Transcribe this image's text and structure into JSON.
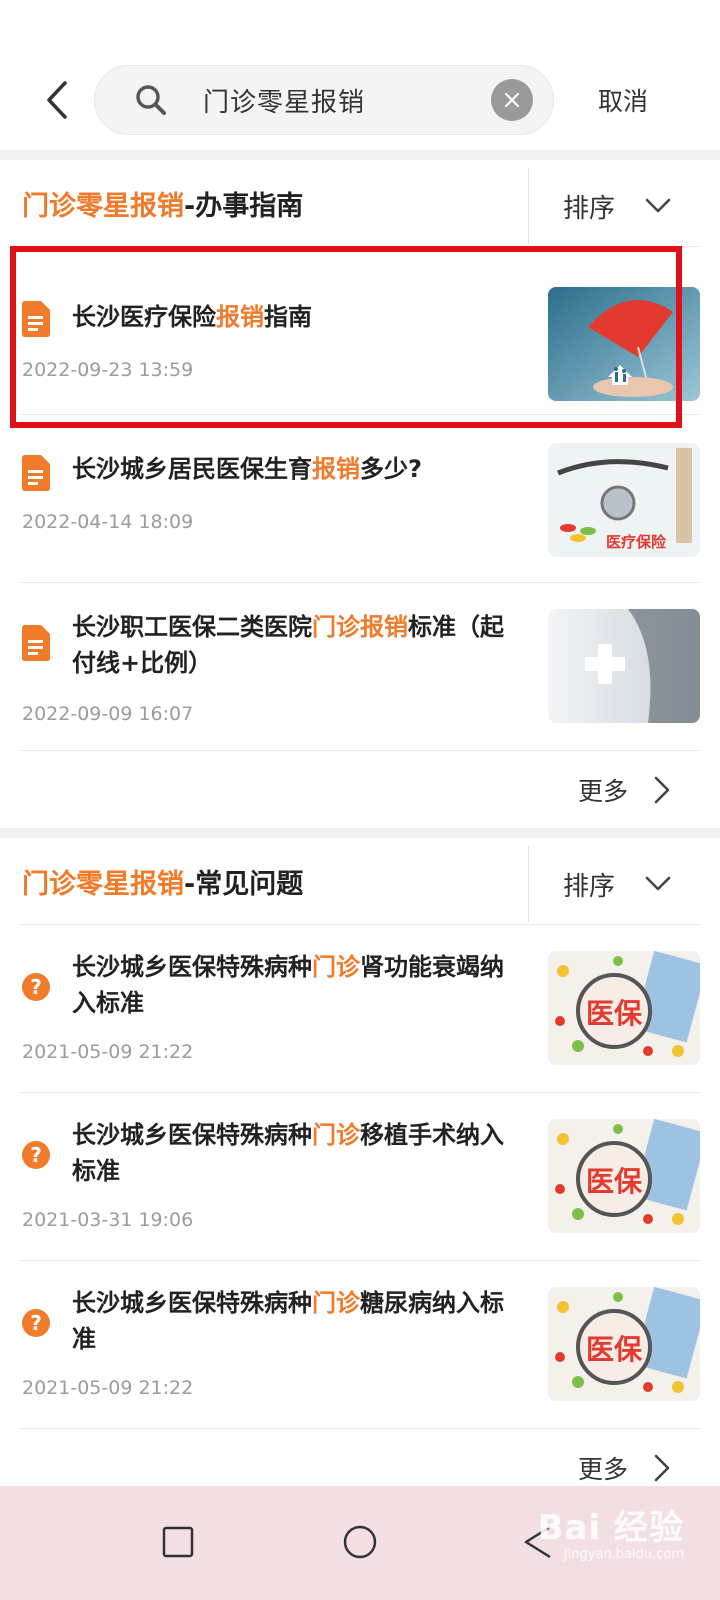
{
  "search": {
    "query": "门诊零星报销",
    "cancel_label": "取消"
  },
  "sections": [
    {
      "title_highlight": "门诊零星报销",
      "title_rest": "-办事指南",
      "sort_label": "排序",
      "more_label": "更多",
      "items": [
        {
          "title_parts": [
            "长沙医疗保险",
            "报销",
            "指南"
          ],
          "date": "2022-09-23 13:59"
        },
        {
          "title_parts": [
            "长沙城乡居民医保生育",
            "报销",
            "多少?"
          ],
          "date": "2022-04-14 18:09",
          "thumb_caption": "医疗保险"
        },
        {
          "title_parts": [
            "长沙职工医保二类医院",
            "门诊报销",
            "标准（起付线+比例）"
          ],
          "date": "2022-09-09 16:07"
        }
      ]
    },
    {
      "title_highlight": "门诊零星报销",
      "title_rest": "-常见问题",
      "sort_label": "排序",
      "more_label": "更多",
      "items": [
        {
          "title_parts": [
            "长沙城乡医保特殊病种",
            "门诊",
            "肾功能衰竭纳入标准"
          ],
          "date": "2021-05-09 21:22",
          "thumb_caption": "医保"
        },
        {
          "title_parts": [
            "长沙城乡医保特殊病种",
            "门诊",
            "移植手术纳入标准"
          ],
          "date": "2021-03-31 19:06",
          "thumb_caption": "医保"
        },
        {
          "title_parts": [
            "长沙城乡医保特殊病种",
            "门诊",
            "糖尿病纳入标准"
          ],
          "date": "2021-05-09 21:22",
          "thumb_caption": "医保"
        }
      ]
    }
  ],
  "watermark": {
    "main": "Bai 经验",
    "sub": "jingyan.baidu.com"
  },
  "colors": {
    "accent": "#f07b2a",
    "highlight_box": "#e0111b",
    "navbar": "#f2dfe3"
  }
}
